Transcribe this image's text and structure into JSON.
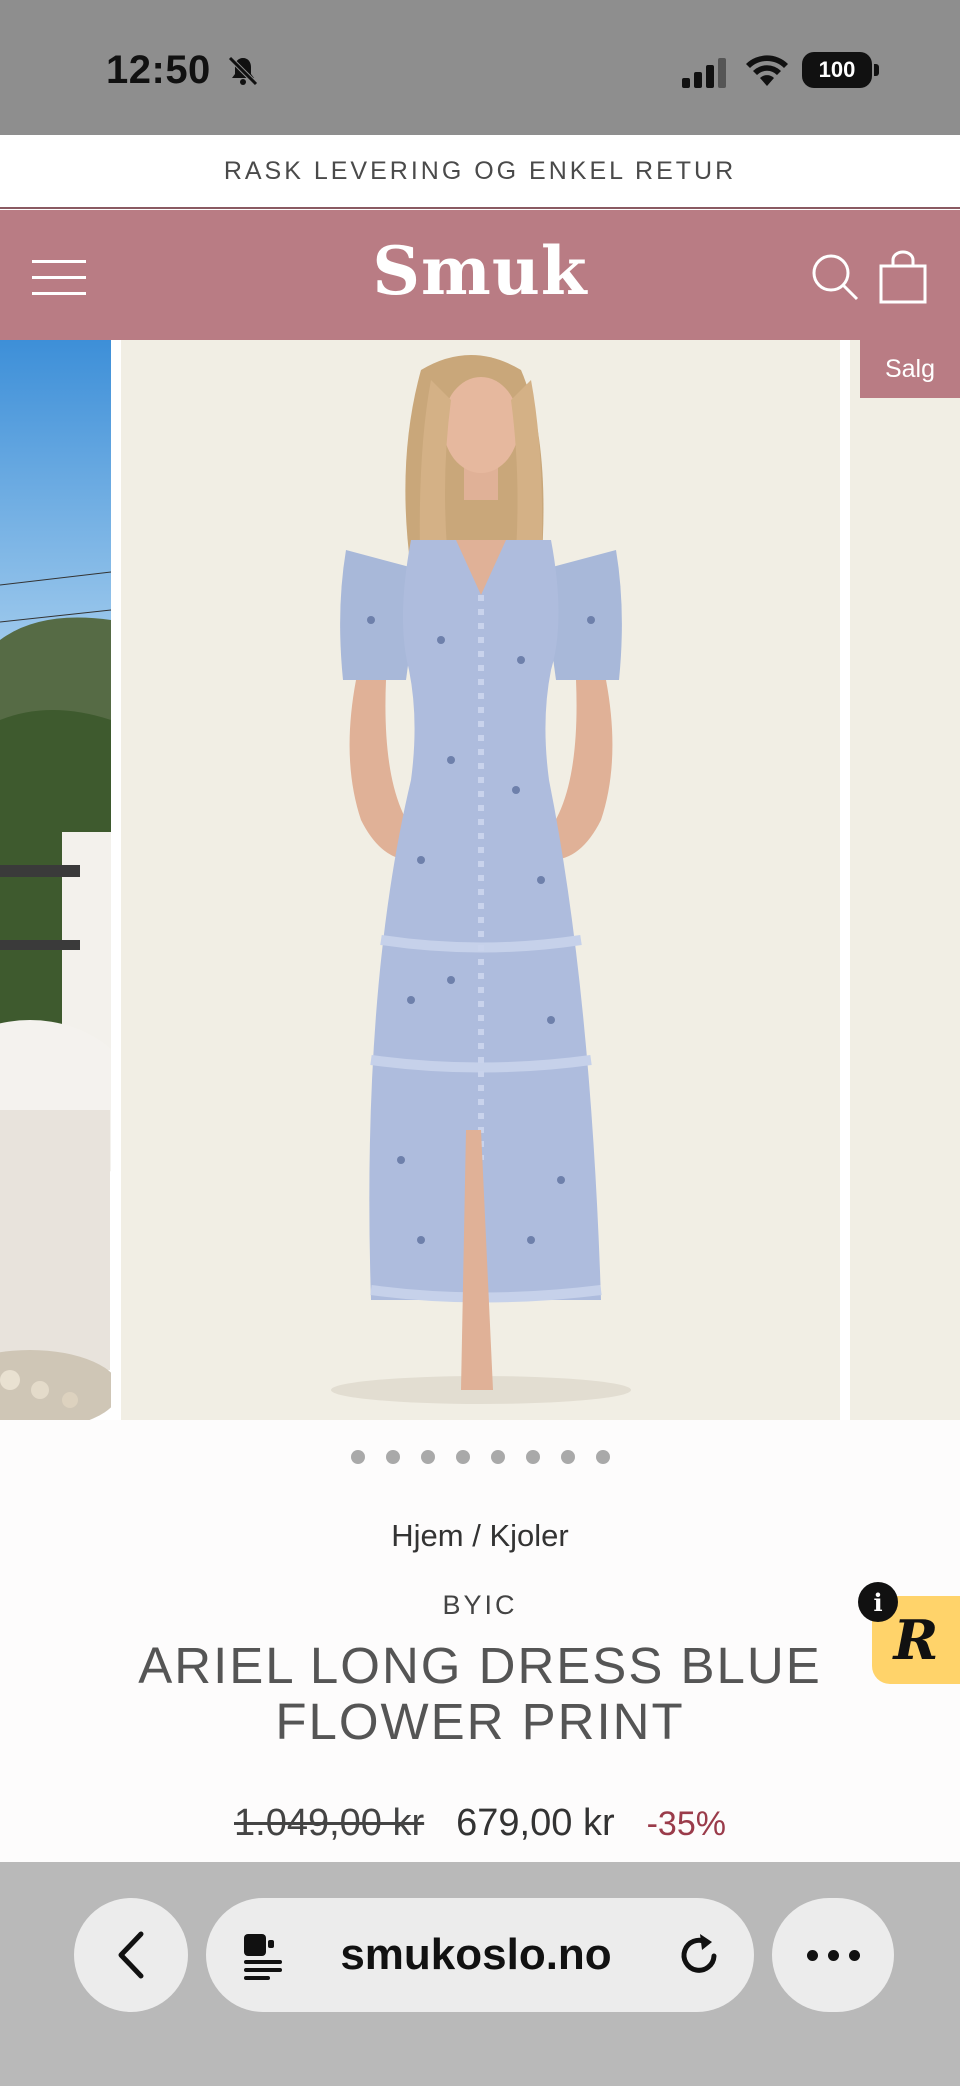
{
  "status_bar": {
    "time": "12:50",
    "battery": "100"
  },
  "announcement": "RASK LEVERING OG ENKEL RETUR",
  "header": {
    "logo": "Smuk"
  },
  "gallery": {
    "sale_badge": "Salg",
    "slide_count": 8,
    "active_slide": 1
  },
  "breadcrumb": "Hjem / Kjoler",
  "product": {
    "vendor": "BYIC",
    "title": "ARIEL LONG DRESS BLUE FLOWER PRINT",
    "price_old": "1.049,00 kr",
    "price_new": "679,00 kr",
    "discount": "-35%"
  },
  "widget": {
    "info": "i",
    "logo_letter": "R"
  },
  "browser": {
    "url": "smukoslo.no"
  },
  "colors": {
    "brand": "#b97c84",
    "discount": "#9a3b4a",
    "product_bg": "#f1eee4"
  }
}
